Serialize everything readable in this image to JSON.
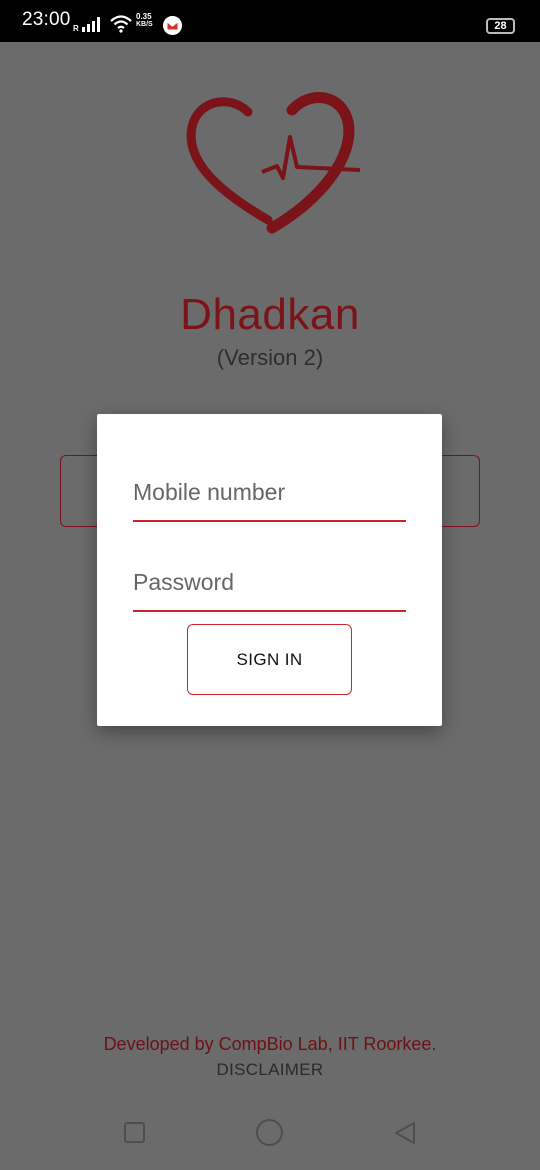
{
  "status_bar": {
    "time": "23:00",
    "network_label": "R",
    "speed_value": "0.35",
    "speed_unit": "KB/S",
    "battery": "28"
  },
  "app": {
    "title": "Dhadkan",
    "version": "(Version 2)",
    "brand_color": "#7a1418"
  },
  "login_dialog": {
    "mobile_placeholder": "Mobile number",
    "password_placeholder": "Password",
    "signin_label": "SIGN IN",
    "accent_color": "#c8242c"
  },
  "footer": {
    "developer_text": "Developed by CompBio Lab, IIT Roorkee.",
    "disclaimer_label": "DISCLAIMER"
  },
  "nav_bar": {
    "icons": [
      "recent-apps-icon",
      "home-icon",
      "back-icon"
    ]
  }
}
